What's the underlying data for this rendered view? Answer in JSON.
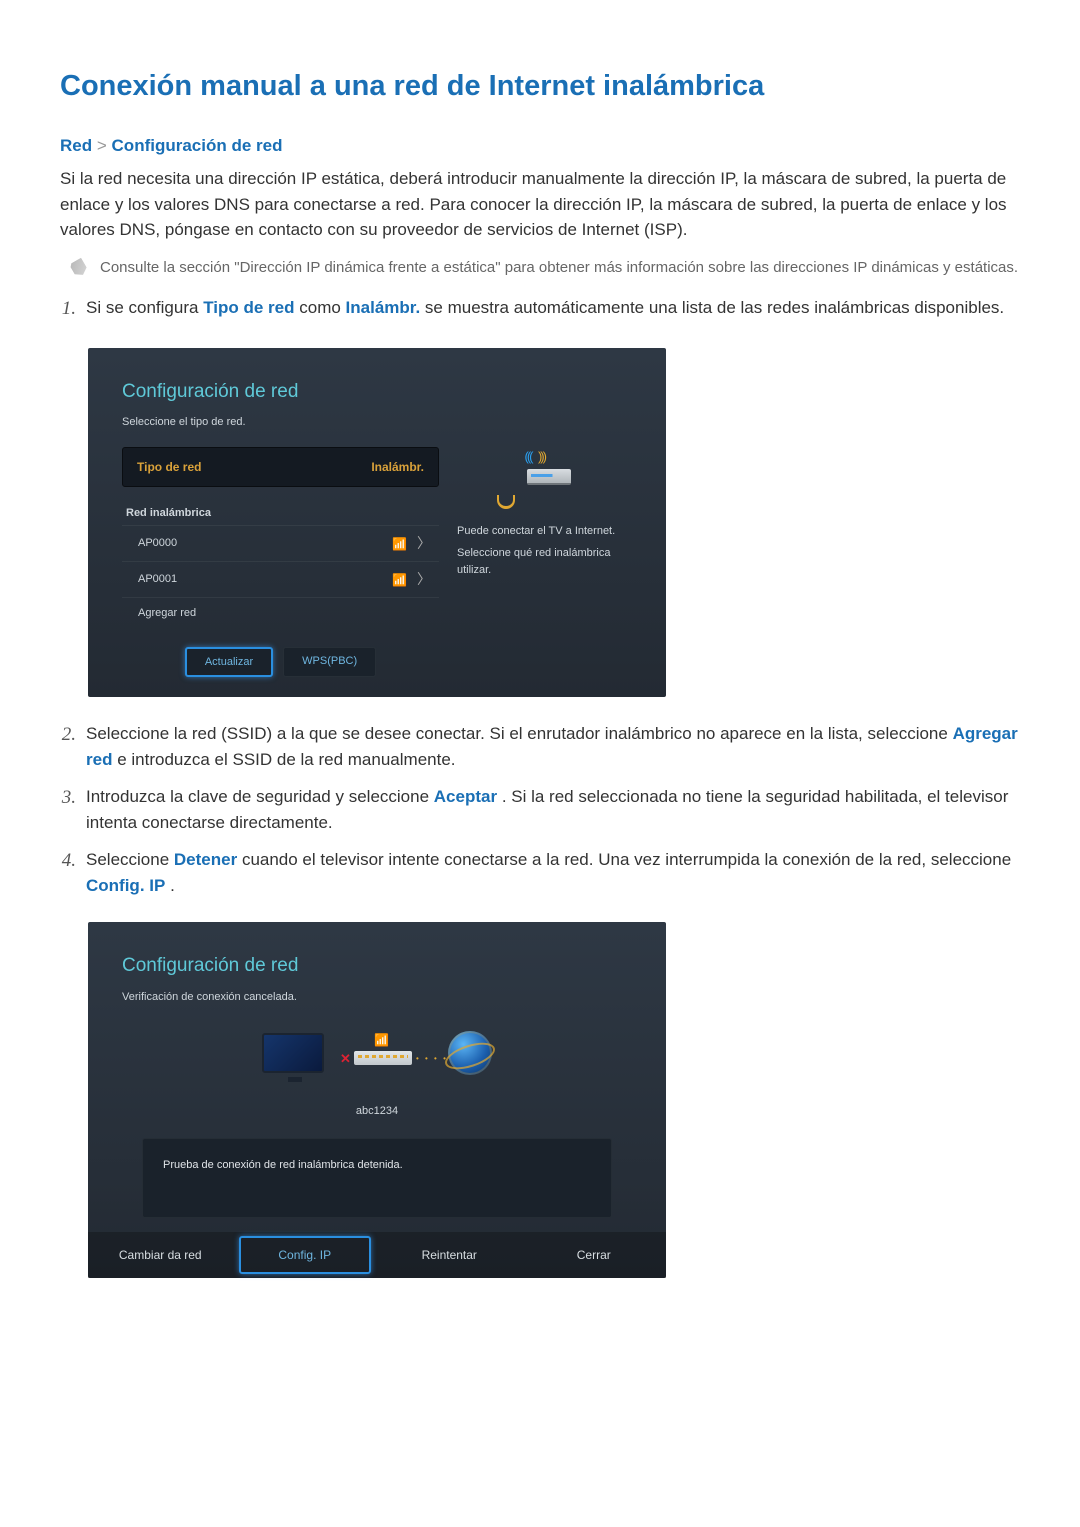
{
  "page": {
    "title": "Conexión manual a una red de Internet inalámbrica"
  },
  "breadcrumb": {
    "a": "Red",
    "sep": ">",
    "b": "Configuración de red"
  },
  "intro": "Si la red necesita una dirección IP estática, deberá introducir manualmente la dirección IP, la máscara de subred, la puerta de enlace y los valores DNS para conectarse a red. Para conocer la dirección IP, la máscara de subred, la puerta de enlace y los valores DNS, póngase en contacto con su proveedor de servicios de Internet (ISP).",
  "note": "Consulte la sección \"Dirección IP dinámica frente a estática\" para obtener más información sobre las direcciones IP dinámicas y estáticas.",
  "steps": {
    "s1a": "Si se configura ",
    "s1_kw1": "Tipo de red",
    "s1b": " como ",
    "s1_kw2": "Inalámbr.",
    "s1c": " se muestra automáticamente una lista de las redes inalámbricas disponibles.",
    "s2a": "Seleccione la red (SSID) a la que se desee conectar. Si el enrutador inalámbrico no aparece en la lista, seleccione ",
    "s2_kw": "Agregar red",
    "s2b": " e introduzca el SSID de la red manualmente.",
    "s3a": "Introduzca la clave de seguridad y seleccione ",
    "s3_kw": "Aceptar",
    "s3b": ". Si la red seleccionada no tiene la seguridad habilitada, el televisor intenta conectarse directamente.",
    "s4a": "Seleccione ",
    "s4_kw1": "Detener",
    "s4b": " cuando el televisor intente conectarse a la red. Una vez interrumpida la conexión de la red, seleccione ",
    "s4_kw2": "Config. IP",
    "s4c": "."
  },
  "nums": {
    "n1": "1.",
    "n2": "2.",
    "n3": "3.",
    "n4": "4."
  },
  "panel1": {
    "title": "Configuración de red",
    "subtitle": "Seleccione el tipo de red.",
    "type_label": "Tipo de red",
    "type_value": "Inalámbr.",
    "wireless_heading": "Red inalámbrica",
    "networks": [
      {
        "ssid": "AP0000"
      },
      {
        "ssid": "AP0001"
      }
    ],
    "add_network": "Agregar red",
    "btn_refresh": "Actualizar",
    "btn_wps": "WPS(PBC)",
    "help_l1": "Puede conectar el TV a Internet.",
    "help_l2": "Seleccione qué red inalámbrica utilizar."
  },
  "panel2": {
    "title": "Configuración de red",
    "subtitle": "Verificación de conexión cancelada.",
    "ssid": "abc1234",
    "message": "Prueba de conexión de red inalámbrica detenida.",
    "btn_change": "Cambiar da red",
    "btn_config": "Config. IP",
    "btn_retry": "Reintentar",
    "btn_close": "Cerrar"
  }
}
